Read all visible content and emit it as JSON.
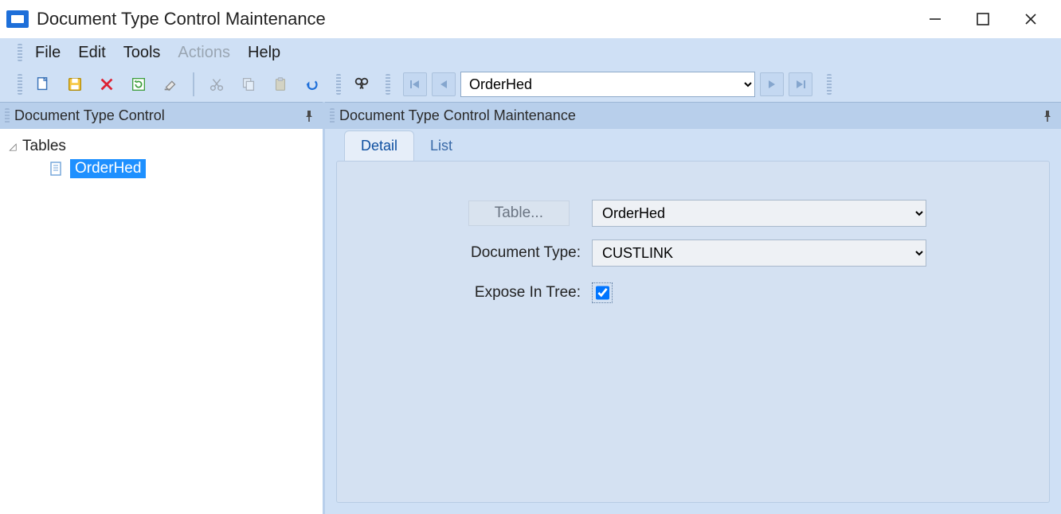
{
  "window": {
    "title": "Document Type Control Maintenance"
  },
  "menu": {
    "file": "File",
    "edit": "Edit",
    "tools": "Tools",
    "actions": "Actions",
    "help": "Help"
  },
  "toolbar": {
    "nav_value": "OrderHed"
  },
  "panes": {
    "left_title": "Document Type Control",
    "right_title": "Document Type Control Maintenance"
  },
  "tree": {
    "root": "Tables",
    "items": [
      "OrderHed"
    ]
  },
  "tabs": {
    "detail": "Detail",
    "list": "List"
  },
  "form": {
    "table_button": "Table...",
    "table_value": "OrderHed",
    "doc_type_label": "Document Type:",
    "doc_type_value": "CUSTLINK",
    "expose_label": "Expose In Tree:",
    "expose_checked": true
  }
}
